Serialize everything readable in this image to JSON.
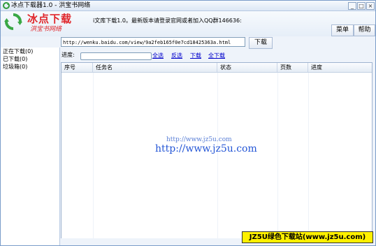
{
  "window": {
    "title": "冰点下载器1.0 - 洪宝书网络"
  },
  "window_controls": {
    "minimize": "_",
    "maximize": "□",
    "close": "×"
  },
  "brand": {
    "title": "冰点下载",
    "subtitle": "洪宝书网络"
  },
  "header": {
    "notice": "i文库下载1.0。最新版本请登录官网或者加入QQ群146636:",
    "menu_label": "菜单",
    "help_label": "帮助"
  },
  "sidebar": {
    "items": [
      {
        "label": "正在下载(0)"
      },
      {
        "label": "已下载(0)"
      },
      {
        "label": "垃圾箱(0)"
      }
    ]
  },
  "download": {
    "url_value": "http://wenku.baidu.com/view/9a2feb165f0e7cd18425363a.html",
    "button_label": "下载"
  },
  "progress": {
    "label": "进度:",
    "value_percent": 0,
    "links": {
      "select_all": "全选",
      "invert": "反选",
      "download": "下载",
      "download_all": "全下载"
    }
  },
  "table": {
    "columns": [
      "序号",
      "任务名",
      "状态",
      "页数",
      "进度"
    ],
    "rows": []
  },
  "watermark": {
    "small": "http://www.jz5u.com",
    "large": "http://www.jz5u.com"
  },
  "badge": {
    "text": "JZ5U绿色下载站(www.jz5u.com)"
  }
}
